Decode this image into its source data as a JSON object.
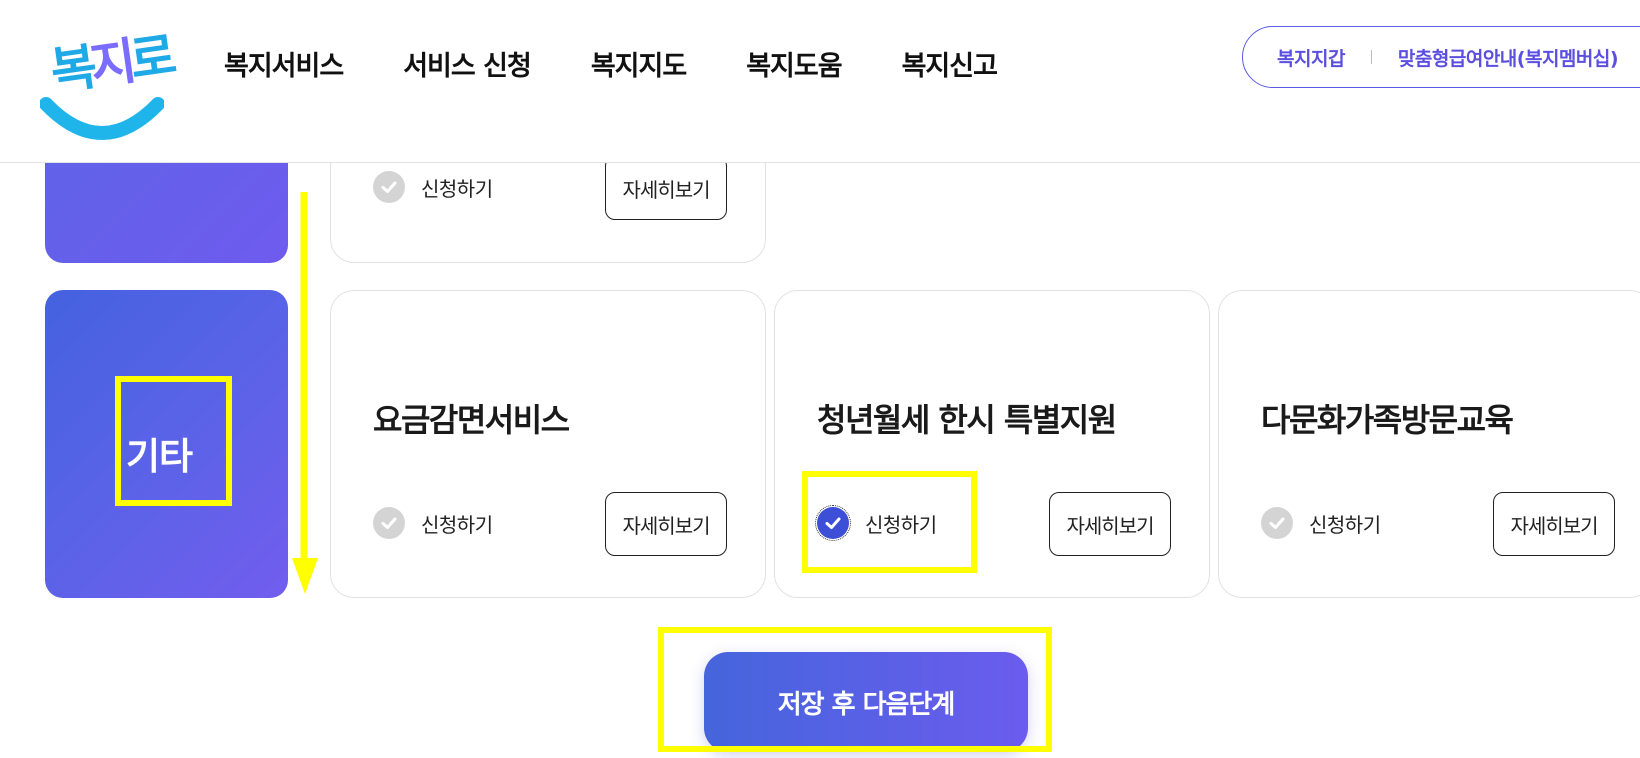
{
  "header": {
    "logo_alt": "복지로",
    "nav": [
      "복지서비스",
      "서비스 신청",
      "복지지도",
      "복지도움",
      "복지신고"
    ],
    "pill_links": [
      "복지지갑",
      "맞춤형급여안내(복지멤버십)"
    ]
  },
  "category": {
    "label": "기타"
  },
  "cards": [
    {
      "title": "",
      "apply_label": "신청하기",
      "detail_label": "자세히보기",
      "checked": false
    },
    {
      "title": "요금감면서비스",
      "apply_label": "신청하기",
      "detail_label": "자세히보기",
      "checked": false
    },
    {
      "title": "청년월세 한시 특별지원",
      "apply_label": "신청하기",
      "detail_label": "자세히보기",
      "checked": true
    },
    {
      "title": "다문화가족방문교육",
      "apply_label": "신청하기",
      "detail_label": "자세히보기",
      "checked": false
    }
  ],
  "save_button": "저장 후 다음단계",
  "colors": {
    "accent": "#5b5be6",
    "gradient_start": "#4462df",
    "gradient_end": "#725dee",
    "highlight": "#ffff00",
    "check_on": "#3d4fd6",
    "check_off": "#d4d4d4"
  },
  "icons": [
    "check-circle-icon",
    "down-arrow-icon"
  ]
}
